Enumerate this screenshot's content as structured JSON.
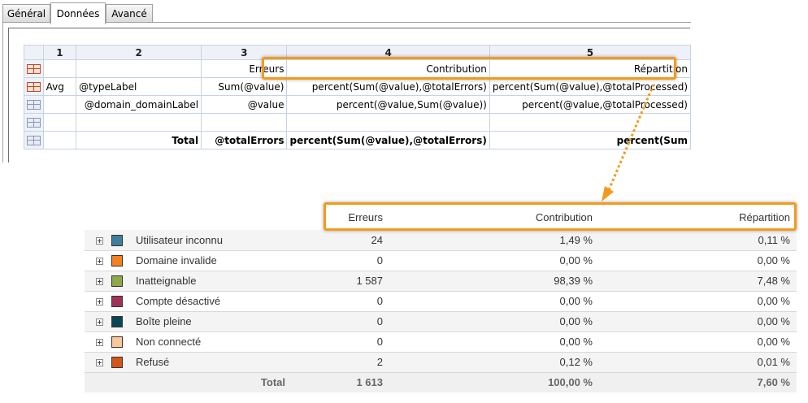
{
  "tabs": [
    {
      "label": "Général",
      "active": false
    },
    {
      "label": "Données",
      "active": true
    },
    {
      "label": "Avancé",
      "active": false
    }
  ],
  "grid": {
    "column_headers": [
      "1",
      "2",
      "3",
      "4",
      "5"
    ],
    "rows": [
      {
        "type": "header-row",
        "cells": [
          "",
          "",
          "Erreurs",
          "Contribution",
          "Répartition"
        ]
      },
      {
        "type": "group-row",
        "cells": [
          "Avg",
          "@typeLabel",
          "Sum(@value)",
          "percent(Sum(@value),@totalErrors)",
          "percent(Sum(@value),@totalProcessed)"
        ]
      },
      {
        "type": "detail-row",
        "cells": [
          "",
          "@domain_domainLabel",
          "@value",
          "percent(@value,Sum(@value))",
          "percent(@value,@totalProcessed)"
        ]
      },
      {
        "type": "empty-row",
        "cells": [
          "",
          "",
          "",
          "",
          ""
        ]
      },
      {
        "type": "total-row",
        "cells": [
          "",
          "Total",
          "@totalErrors",
          "percent(Sum(@value),@totalErrors)",
          "percent(Sum"
        ]
      }
    ]
  },
  "result": {
    "headers": [
      "",
      "",
      "Erreurs",
      "Contribution",
      "Répartition"
    ],
    "rows": [
      {
        "label": "Utilisateur inconnu",
        "color": "#3d7f9c",
        "errors": "24",
        "contribution": "1,49 %",
        "repartition": "0,11 %"
      },
      {
        "label": "Domaine invalide",
        "color": "#f58220",
        "errors": "0",
        "contribution": "0,00 %",
        "repartition": "0,00 %"
      },
      {
        "label": "Inatteignable",
        "color": "#8fa84a",
        "errors": "1 587",
        "contribution": "98,39 %",
        "repartition": "7,48 %"
      },
      {
        "label": "Compte désactivé",
        "color": "#a0325a",
        "errors": "0",
        "contribution": "0,00 %",
        "repartition": "0,00 %"
      },
      {
        "label": "Boîte pleine",
        "color": "#0b4654",
        "errors": "0",
        "contribution": "0,00 %",
        "repartition": "0,00 %"
      },
      {
        "label": "Non connecté",
        "color": "#f9c89a",
        "errors": "0",
        "contribution": "0,00 %",
        "repartition": "0,00 %"
      },
      {
        "label": "Refusé",
        "color": "#d2561a",
        "errors": "2",
        "contribution": "0,12 %",
        "repartition": "0,01 %"
      }
    ],
    "total": {
      "label": "Total",
      "errors": "1 613",
      "contribution": "100,00 %",
      "repartition": "7,60 %"
    }
  },
  "colors": {
    "highlight": "#f39a1e",
    "grid_border": "#c6d3e2"
  },
  "icons": {
    "expand": "plus-box-icon",
    "row_type": "table-row-icon"
  }
}
